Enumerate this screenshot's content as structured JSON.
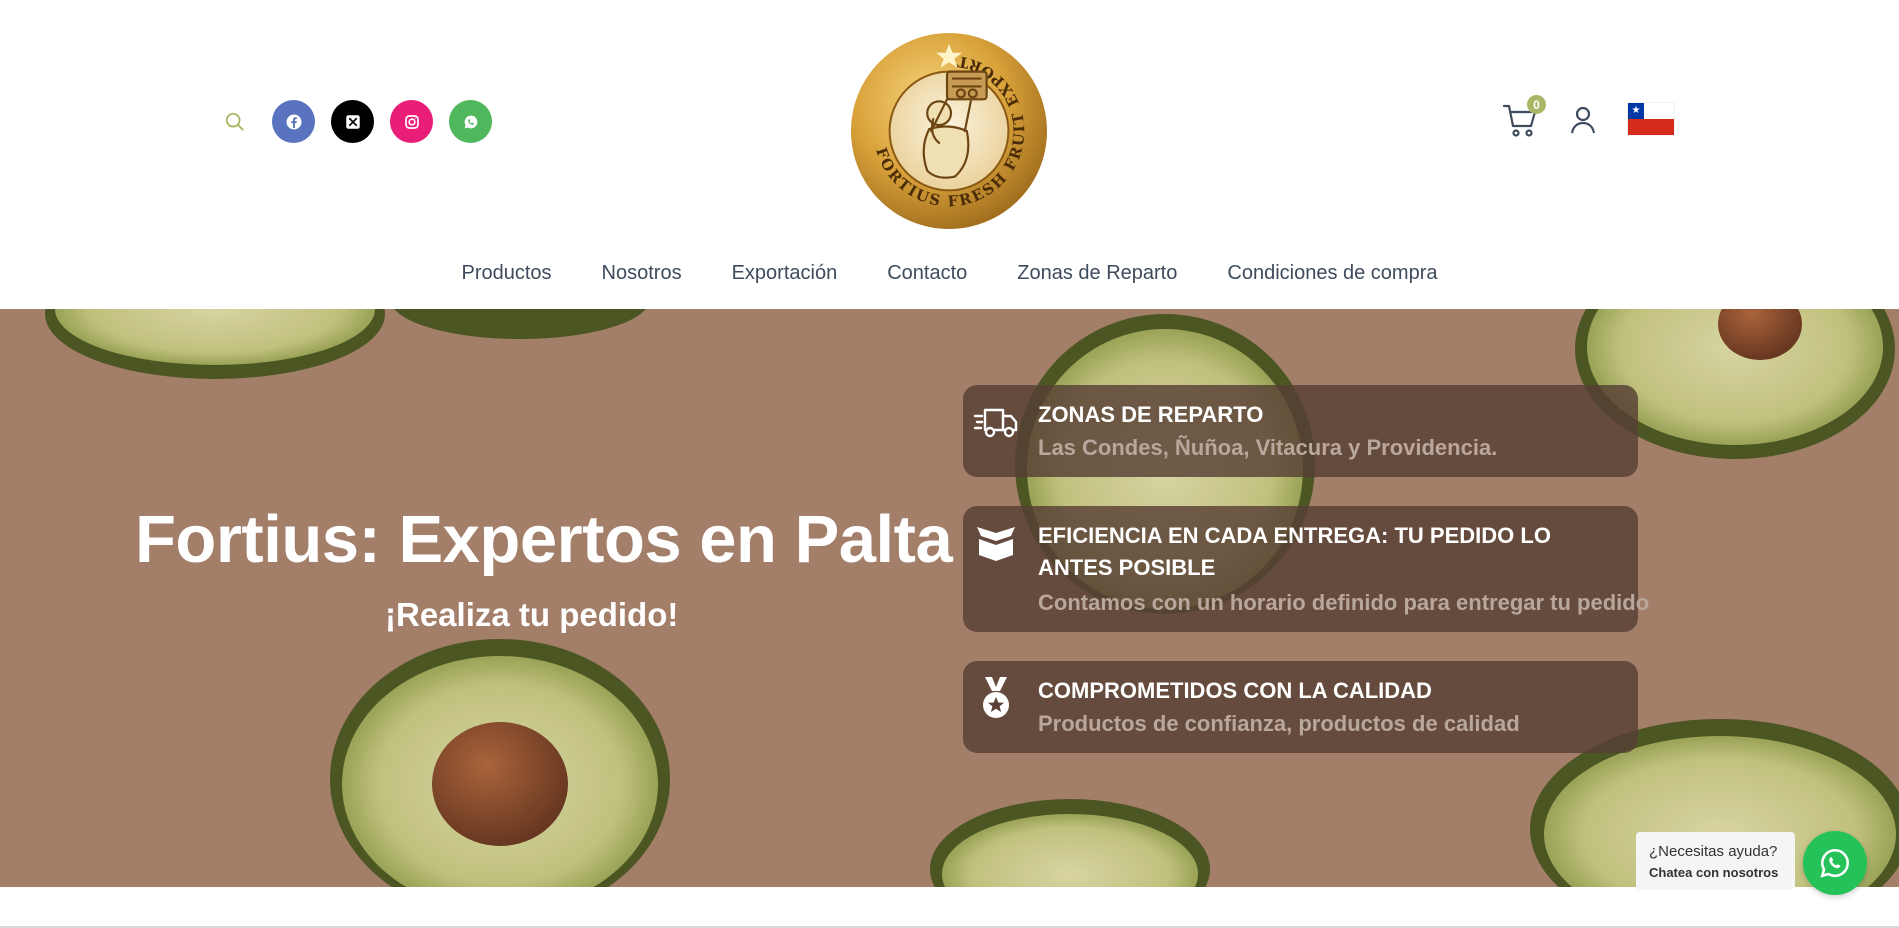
{
  "brand": {
    "logo_text": "FORTIUS FRESH FRUIT EXPORT",
    "colors": {
      "gold": "#d9a23a",
      "accent_green": "#a8b765",
      "nav_text": "#3d4b5c"
    }
  },
  "header": {
    "social": [
      {
        "name": "facebook",
        "color": "#5973be"
      },
      {
        "name": "x",
        "color": "#000000"
      },
      {
        "name": "instagram",
        "color": "#e81e78"
      },
      {
        "name": "whatsapp",
        "color": "#4fb85c"
      }
    ],
    "cart_count": "0",
    "flag": "★"
  },
  "nav": {
    "items": [
      "Productos",
      "Nosotros",
      "Exportación",
      "Contacto",
      "Zonas de Reparto",
      "Condiciones de compra"
    ]
  },
  "hero": {
    "title": "Fortius: Expertos en Palta",
    "subtitle": "¡Realiza tu pedido!",
    "cards": [
      {
        "icon": "delivery-truck-icon",
        "title": "ZONAS DE REPARTO",
        "desc": "Las Condes, Ñuñoa, Vitacura y Providencia."
      },
      {
        "icon": "box-icon",
        "title": "EFICIENCIA EN CADA ENTREGA: TU PEDIDO LO ANTES POSIBLE",
        "desc": "Contamos con un horario definido para entregar tu pedido"
      },
      {
        "icon": "medal-icon",
        "title": "COMPROMETIDOS CON LA CALIDAD",
        "desc": "Productos de confianza, productos de calidad"
      }
    ]
  },
  "help": {
    "question": "¿Necesitas ayuda?",
    "cta": "Chatea con nosotros"
  }
}
